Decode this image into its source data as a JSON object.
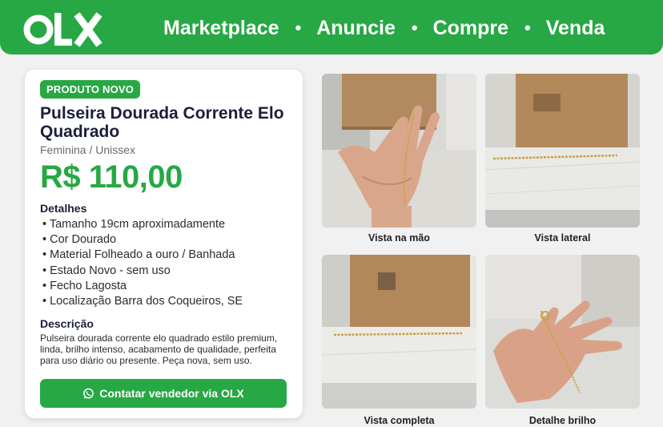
{
  "header": {
    "logo_text": "OLX",
    "nav": [
      "Marketplace",
      "Anuncie",
      "Compre",
      "Venda"
    ],
    "separator": "•"
  },
  "listing": {
    "badge": "PRODUTO NOVO",
    "title": "Pulseira Dourada Corrente Elo Quadrado",
    "subtitle": "Feminina / Unissex",
    "price": "R$ 110,00",
    "details_heading": "Detalhes",
    "details": [
      "Tamanho 19cm aproximadamente",
      "Cor Dourado",
      "Material Folheado a ouro / Banhada",
      "Estado Novo - sem uso",
      "Fecho Lagosta",
      "Localização Barra dos Coqueiros, SE"
    ],
    "description_heading": "Descrição",
    "description": "Pulseira dourada corrente elo quadrado estilo premium, linda, brilho intenso, acabamento de qualidade, perfeita para uso diário ou presente. Peça nova, sem uso.",
    "cta_label": "Contatar vendedor via OLX",
    "cta_icon": "whatsapp-icon"
  },
  "photos": [
    {
      "caption": "Vista na mão"
    },
    {
      "caption": "Vista lateral"
    },
    {
      "caption": "Vista completa"
    },
    {
      "caption": "Detalhe brilho"
    }
  ],
  "colors": {
    "brand_green": "#27a844",
    "title_navy": "#1b1f3b",
    "background": "#f1f1f1"
  }
}
